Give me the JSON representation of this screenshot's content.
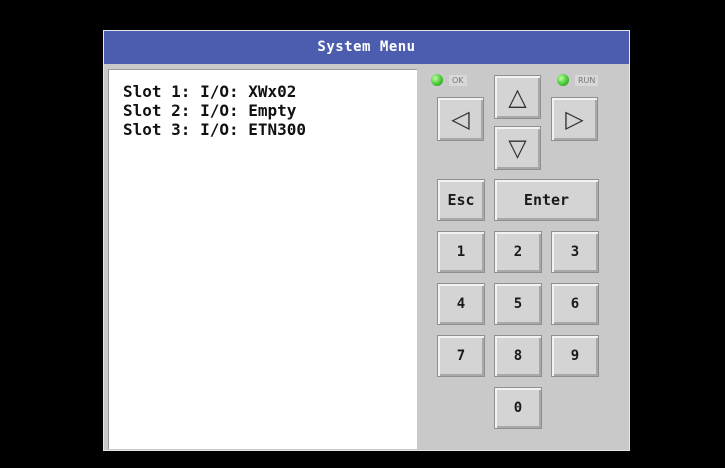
{
  "window": {
    "title": "System Menu"
  },
  "screen": {
    "lines": [
      "Slot 1: I/O: XWx02",
      "Slot 2: I/O: Empty",
      "Slot 3: I/O: ETN300"
    ]
  },
  "indicators": {
    "ok_label": "OK",
    "run_label": "RUN",
    "led_color": "#3fc230"
  },
  "keypad": {
    "up": "△",
    "down": "▽",
    "left": "◁",
    "right": "▷",
    "esc": "Esc",
    "enter": "Enter",
    "k1": "1",
    "k2": "2",
    "k3": "3",
    "k4": "4",
    "k5": "5",
    "k6": "6",
    "k7": "7",
    "k8": "8",
    "k9": "9",
    "k0": "0"
  },
  "colors": {
    "title_bar": "#4c5db0",
    "panel": "#c9c9c9",
    "screen": "#ffffff"
  }
}
